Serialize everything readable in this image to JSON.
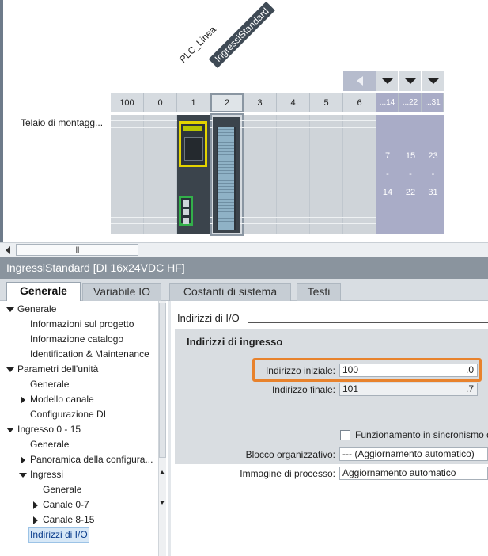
{
  "device_view": {
    "plc_label": "PLC_Linea",
    "module_label": "IngressiStandard",
    "rack_label": "Telaio di montagg...",
    "slots": [
      "100",
      "0",
      "1",
      "2",
      "3",
      "4",
      "5",
      "6"
    ],
    "expansion_slots": [
      {
        "header": "...14",
        "start": "7",
        "dash": "-",
        "end": "14"
      },
      {
        "header": "...22",
        "start": "15",
        "dash": "-",
        "end": "22"
      },
      {
        "header": "...31",
        "start": "23",
        "dash": "-",
        "end": "31"
      }
    ],
    "scrollbar_grip": "|||",
    "colors": {
      "expansion": "#a9acc7",
      "plc_frame": "#e4d400",
      "ethernet": "#33b04a"
    }
  },
  "inspector": {
    "title": "IngressiStandard [DI 16x24VDC HF]",
    "tabs": [
      "Generale",
      "Variabile IO",
      "Costanti di sistema",
      "Testi"
    ],
    "active_tab": "Generale"
  },
  "tree": [
    {
      "label": "Generale",
      "twisty": "down"
    },
    {
      "label": "Informazioni sul progetto",
      "twisty": ""
    },
    {
      "label": "Informazione catalogo",
      "twisty": ""
    },
    {
      "label": "Identification & Maintenance",
      "twisty": ""
    },
    {
      "label": "Parametri dell'unità",
      "twisty": "down"
    },
    {
      "label": "Generale",
      "twisty": ""
    },
    {
      "label": "Modello canale",
      "twisty": "right"
    },
    {
      "label": "Configurazione DI",
      "twisty": ""
    },
    {
      "label": "Ingresso 0 - 15",
      "twisty": "down"
    },
    {
      "label": "Generale",
      "twisty": ""
    },
    {
      "label": "Panoramica della configura...",
      "twisty": "right"
    },
    {
      "label": "Ingressi",
      "twisty": "down"
    },
    {
      "label": "Generale",
      "twisty": ""
    },
    {
      "label": "Canale 0-7",
      "twisty": "right"
    },
    {
      "label": "Canale 8-15",
      "twisty": "right"
    },
    {
      "label": "Indirizzi di I/O",
      "twisty": "",
      "selected": true
    }
  ],
  "content": {
    "section_title": "Indirizzi di I/O",
    "group_title": "Indirizzi di ingresso",
    "start_address": {
      "label": "Indirizzo iniziale:",
      "value": "100",
      "bit": ".0"
    },
    "end_address": {
      "label": "Indirizzo finale:",
      "value": "101",
      "bit": ".7"
    },
    "isochronous": {
      "label": "Funzionamento in sincronismo di",
      "checked": false
    },
    "org_block": {
      "label": "Blocco organizzativo:",
      "value": "--- (Aggiornamento automatico)"
    },
    "process_image": {
      "label": "Immagine di processo:",
      "value": "Aggiornamento automatico"
    },
    "highlight_color": "#e8822c"
  }
}
